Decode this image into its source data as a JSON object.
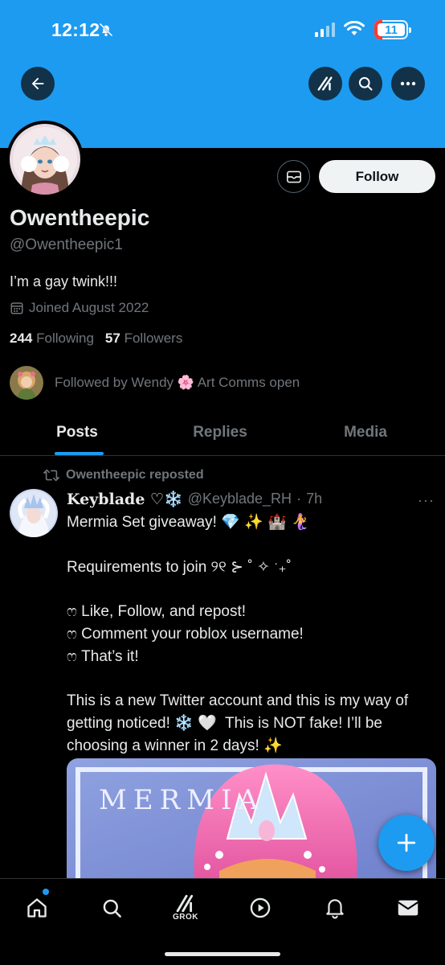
{
  "status_bar": {
    "time": "12:12",
    "battery_level": "11"
  },
  "colors": {
    "accent": "#1d9bf0",
    "background": "#000000",
    "text_primary": "#e7e9ea",
    "text_secondary": "#71767b"
  },
  "header": {
    "back_icon": "arrow-left-icon",
    "grok_icon": "grok-icon",
    "search_icon": "search-icon",
    "more_icon": "ellipsis-icon"
  },
  "profile": {
    "display_name": "Owentheepic",
    "handle": "@Owentheepic1",
    "bio": "I’m a gay twink!!!",
    "joined": "Joined August 2022",
    "following_count": "244",
    "following_label": "Following",
    "followers_count": "57",
    "followers_label": "Followers",
    "followed_by": "Followed by Wendy 🌸 Art Comms open",
    "follow_label": "Follow"
  },
  "tabs": [
    {
      "label": "Posts",
      "active": true
    },
    {
      "label": "Replies",
      "active": false
    },
    {
      "label": "Media",
      "active": false
    }
  ],
  "post": {
    "repost_label": "Owentheepic reposted",
    "author_name": "Keyblade ♡❄️",
    "author_handle": "@Keyblade_RH",
    "separator": "·",
    "time": "7h",
    "more": "···",
    "text": "Mermia Set giveaway! 💎 ✨ 🏰 🧜‍♀️\n\nRequirements to join ୨୧ ⊱ ˚ ✧ ˑ₊˚\n\nෆ Like, Follow, and repost!\nෆ Comment your roblox username!\nෆ That’s it!\n\nThis is a new Twitter account and this is my way of getting noticed! ❄️ 🤍  This is NOT fake! I’ll be choosing a winner in 2 days! ✨",
    "image_title": "MERMIA"
  },
  "bottom_nav": {
    "items": [
      {
        "icon": "home-icon"
      },
      {
        "icon": "search-icon"
      },
      {
        "icon": "grok-icon",
        "label": "GROK"
      },
      {
        "icon": "video-icon"
      },
      {
        "icon": "bell-icon"
      },
      {
        "icon": "mail-icon"
      }
    ]
  }
}
